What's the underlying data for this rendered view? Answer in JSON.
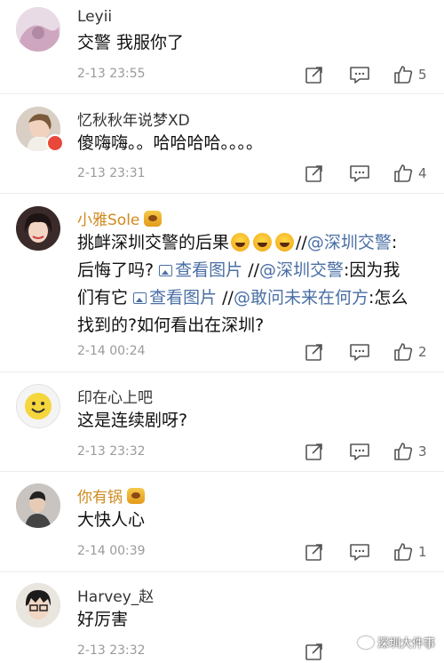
{
  "comments": [
    {
      "name": "Leyii",
      "text": "交警 我服你了",
      "time": "2-13 23:55",
      "likes": "5"
    },
    {
      "name": "忆秋秋年说梦XD",
      "text": "傻嗨嗨。。哈哈哈哈。。。。",
      "time": "2-13 23:31",
      "likes": "4"
    },
    {
      "name": "小雅Sole",
      "text_line1_a": "挑衅深圳交警的后果",
      "text_line1_b": "//",
      "mention1": "@深圳交警",
      "text_line1_c": ":",
      "text_line2_a": "后悔了吗?",
      "link1": "查看图片",
      "text_line2_b": "//",
      "mention2": "@深圳交警",
      "text_line2_c": ":因为我",
      "text_line3_a": "们有它",
      "link2": "查看图片",
      "text_line3_b": "//",
      "mention3": "@敢问未来在何方",
      "text_line3_c": ":怎么",
      "text_line4": "找到的?如何看出在深圳?",
      "time": "2-14 00:24",
      "likes": "2"
    },
    {
      "name": "印在心上吧",
      "text": "这是连续剧呀?",
      "time": "2-13 23:32",
      "likes": "3"
    },
    {
      "name": "你有锅",
      "text": "大快人心",
      "time": "2-14 00:39",
      "likes": "1"
    },
    {
      "name": "Harvey_赵",
      "text": "好厉害",
      "time": "2-13 23:32",
      "likes": ""
    }
  ],
  "watermark": "深圳大件事",
  "colors": {
    "mention": "#4a6fa5",
    "vip_name": "#d08a1e",
    "time": "#9a9a9a"
  }
}
